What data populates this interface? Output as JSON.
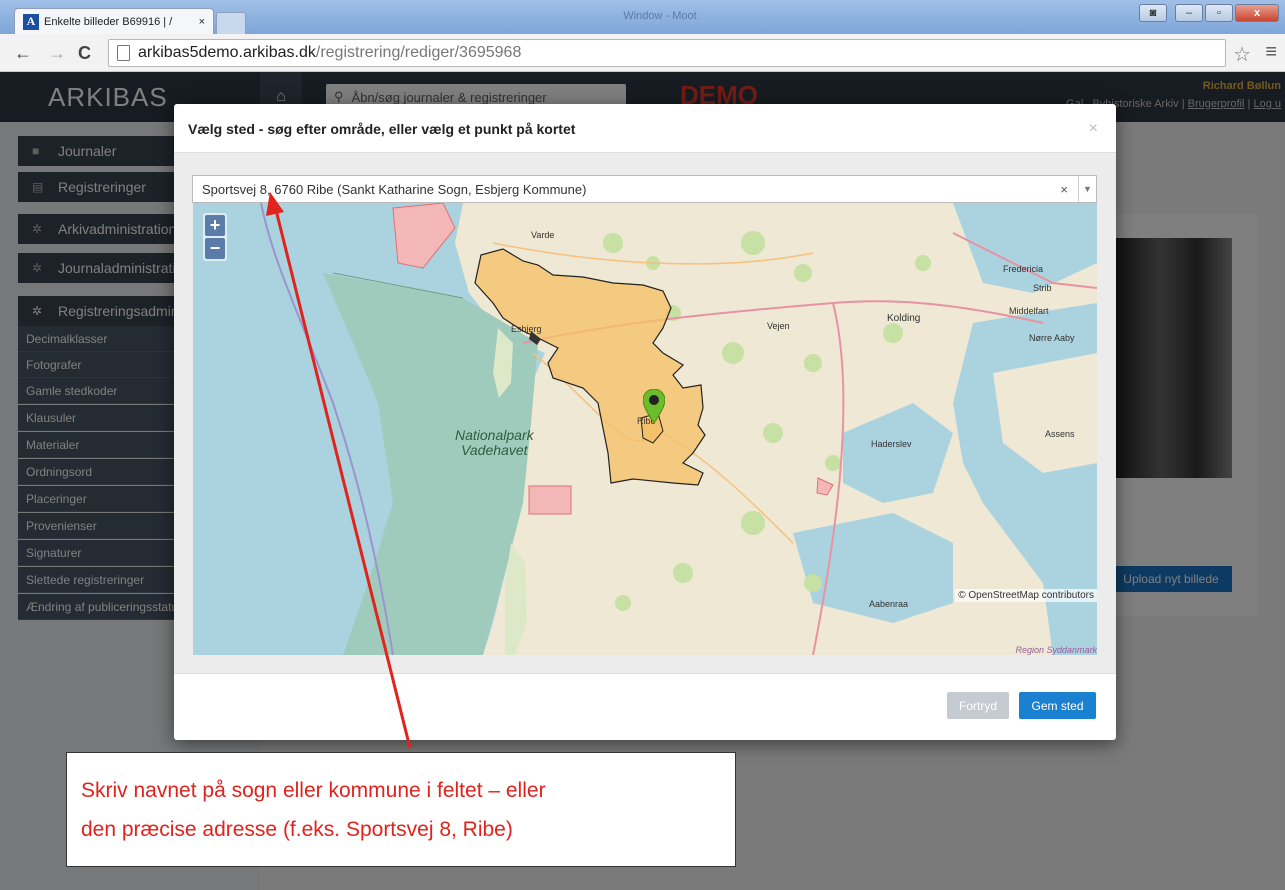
{
  "browser": {
    "tab_title": "Enkelte billeder B69916 | /",
    "tab_close": "×",
    "window_title": "Window - Moot",
    "favicon_letter": "A",
    "url_host": "arkibas5demo.arkibas.dk",
    "url_path": "/registrering/rediger/3695968"
  },
  "app": {
    "logo": "ARKIBAS",
    "search_placeholder": "Åbn/søg journaler & registreringer",
    "demo_label": "DEMO",
    "user_name": "Richard Bøllun",
    "user_org": "Gal.. Byhistoriske Arkiv | ",
    "user_profile": "Brugerprofil",
    "user_logout": "Log u",
    "upload_button": "Upload nyt billede"
  },
  "sidebar": {
    "sections": [
      {
        "label": "Journaler",
        "icon": "folder-icon"
      },
      {
        "label": "Registreringer",
        "icon": "list-icon"
      },
      {
        "label": "Arkivadministration",
        "icon": "gear-icon"
      },
      {
        "label": "Journaladministration",
        "icon": "gear-icon"
      },
      {
        "label": "Registreringsadministration",
        "icon": "gear-icon"
      }
    ],
    "subitems": [
      "Decimalklasser",
      "Fotografer",
      "Gamle stedkoder",
      "Klausuler",
      "Materialer",
      "Ordningsord",
      "Placeringer",
      "Provenienser",
      "Signaturer",
      "Slettede registreringer",
      "Ændring af publiceringsstatus"
    ]
  },
  "modal": {
    "title": "Vælg sted - søg efter område, eller vælg et punkt på kortet",
    "close": "×",
    "place_value": "Sportsvej 8, 6760 Ribe (Sankt Katharine Sogn, Esbjerg Kommune)",
    "clear": "×",
    "cancel_button": "Fortryd",
    "save_button": "Gem sted"
  },
  "map": {
    "zoom_in": "+",
    "zoom_out": "−",
    "labels": {
      "varde": "Varde",
      "esbjerg": "Esbjerg",
      "vejen": "Vejen",
      "kolding": "Kolding",
      "fredericia": "Fredericia",
      "strib": "Strib",
      "middelfart": "Middelfart",
      "norre_aaby": "Nørre Aaby",
      "ribe": "Ribe",
      "haderslev": "Haderslev",
      "assens": "Assens",
      "aabenraa": "Aabenraa",
      "national_park_1": "Nationalpark",
      "national_park_2": "Vadehavet"
    },
    "attribution": "© OpenStreetMap contributors",
    "region": "Region Syddanmark",
    "colors": {
      "sea": "#aad3df",
      "wadden": "#9fcbbd",
      "land": "#eee8d4",
      "selection": "#f5c06a",
      "marker": "#6bbd2b"
    }
  },
  "callout": {
    "line1": "Skriv navnet på sogn eller kommune i feltet – eller",
    "line2": "den præcise adresse (f.eks. Sportsvej 8, Ribe)",
    "color": "#e2221c"
  }
}
